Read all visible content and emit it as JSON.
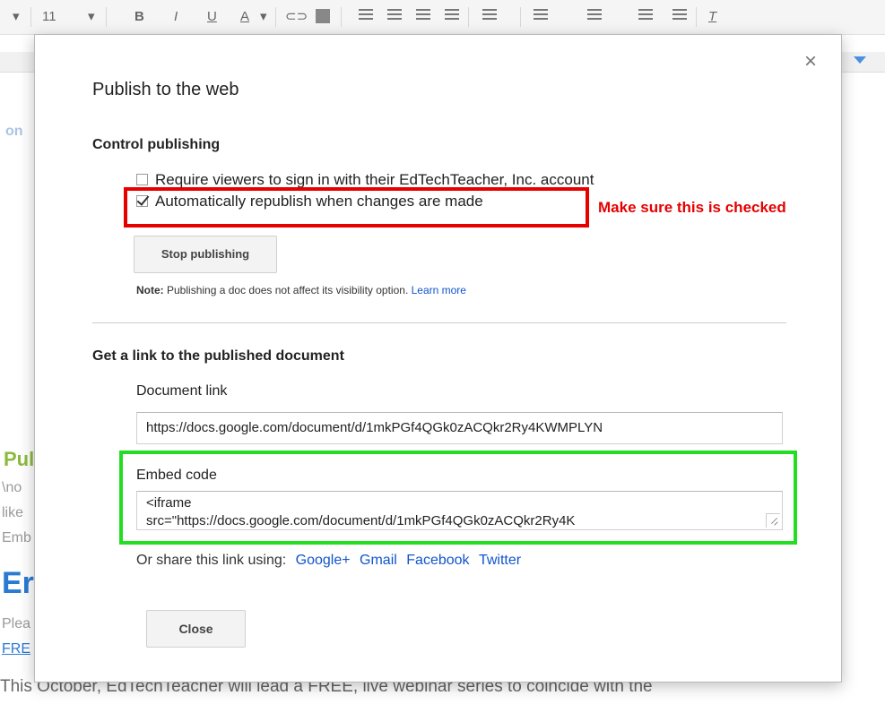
{
  "toolbar": {
    "font_size": "11",
    "bold": "B",
    "italic": "I",
    "underline": "U",
    "text_color": "A"
  },
  "background": {
    "fragments_left": [
      "on",
      "Pul",
      "\\no",
      "like",
      "Emb",
      "Er",
      "Plea",
      "FRE"
    ],
    "bottom_text": "This October, EdTechTeacher will lead a FREE, live webinar series to coincide with the"
  },
  "dialog": {
    "title": "Publish to the web",
    "close_label": "×",
    "control_publishing": {
      "heading": "Control publishing",
      "require_sign_in": {
        "label": "Require viewers to sign in with their EdTechTeacher, Inc. account",
        "checked": false
      },
      "auto_republish": {
        "label": "Automatically republish when changes are made",
        "checked": true
      },
      "stop_button": "Stop publishing",
      "note_bold": "Note:",
      "note_text": " Publishing a doc does not affect its visibility option. ",
      "learn_more": "Learn more"
    },
    "link_section": {
      "heading": "Get a link to the published document",
      "document_link_label": "Document link",
      "document_link_value": "https://docs.google.com/document/d/1mkPGf4QGk0zACQkr2Ry4KWMPLYN",
      "embed_label": "Embed code",
      "embed_line1": "<iframe",
      "embed_line2": "src=\"https://docs.google.com/document/d/1mkPGf4QGk0zACQkr2Ry4K",
      "share_prefix": "Or share this link using:",
      "share_links": [
        "Google+",
        "Gmail",
        "Facebook",
        "Twitter"
      ]
    },
    "close_button": "Close"
  },
  "annotations": {
    "red_note": "Make sure this is checked",
    "red_color": "#e60000",
    "green_color": "#22dd22"
  }
}
